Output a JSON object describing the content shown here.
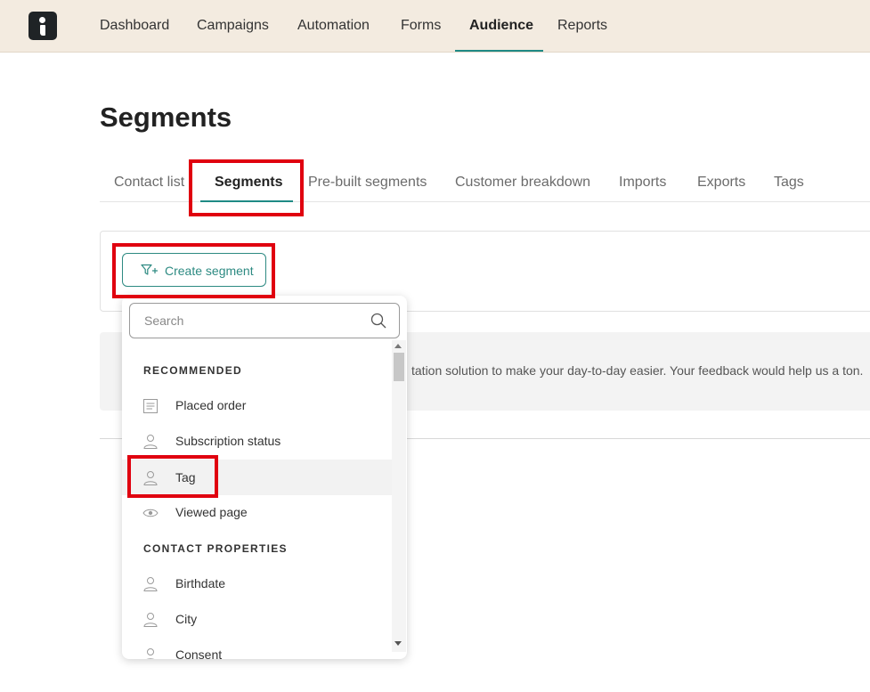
{
  "nav": {
    "logo_icon": "brand-logo",
    "items": [
      {
        "label": "Dashboard"
      },
      {
        "label": "Campaigns"
      },
      {
        "label": "Automation"
      },
      {
        "label": "Forms"
      },
      {
        "label": "Audience",
        "active": true
      },
      {
        "label": "Reports"
      }
    ]
  },
  "page": {
    "title": "Segments"
  },
  "tabs": [
    {
      "label": "Contact list"
    },
    {
      "label": "Segments",
      "active": true
    },
    {
      "label": "Pre-built segments"
    },
    {
      "label": "Customer breakdown"
    },
    {
      "label": "Imports"
    },
    {
      "label": "Exports"
    },
    {
      "label": "Tags"
    }
  ],
  "toolbar": {
    "create_segment_label": "Create segment",
    "create_segment_icon": "filter-plus-icon"
  },
  "banner": {
    "text": "tation solution to make your day-to-day easier. Your feedback would help us a ton."
  },
  "dropdown": {
    "search_placeholder": "Search",
    "sections": [
      {
        "heading": "RECOMMENDED",
        "items": [
          {
            "label": "Placed order",
            "icon": "document-icon"
          },
          {
            "label": "Subscription status",
            "icon": "person-icon"
          },
          {
            "label": "Tag",
            "icon": "person-icon",
            "hovered": true
          },
          {
            "label": "Viewed page",
            "icon": "eye-icon"
          }
        ]
      },
      {
        "heading": "CONTACT PROPERTIES",
        "items": [
          {
            "label": "Birthdate",
            "icon": "person-icon"
          },
          {
            "label": "City",
            "icon": "person-icon"
          },
          {
            "label": "Consent",
            "icon": "person-icon"
          }
        ]
      }
    ]
  },
  "colors": {
    "accent": "#1f8a85",
    "nav_bg": "#f3ebe0",
    "highlight": "#e0000f"
  }
}
